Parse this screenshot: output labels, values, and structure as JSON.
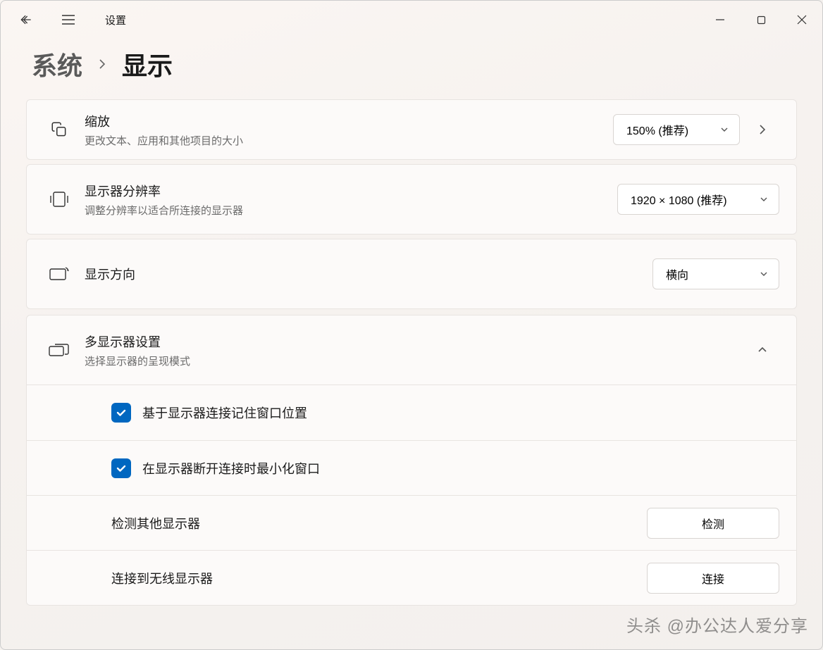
{
  "app_title": "设置",
  "breadcrumb": {
    "parent": "系统",
    "current": "显示"
  },
  "scale": {
    "title": "缩放",
    "sub": "更改文本、应用和其他项目的大小",
    "value": "150% (推荐)"
  },
  "resolution": {
    "title": "显示器分辨率",
    "sub": "调整分辨率以适合所连接的显示器",
    "value": "1920 × 1080 (推荐)"
  },
  "orientation": {
    "title": "显示方向",
    "value": "横向"
  },
  "multi": {
    "title": "多显示器设置",
    "sub": "选择显示器的呈现模式",
    "opt1": "基于显示器连接记住窗口位置",
    "opt2": "在显示器断开连接时最小化窗口",
    "detect_label": "检测其他显示器",
    "detect_btn": "检测",
    "connect_label": "连接到无线显示器",
    "connect_btn": "连接"
  },
  "watermark": "头杀 @办公达人爱分享"
}
